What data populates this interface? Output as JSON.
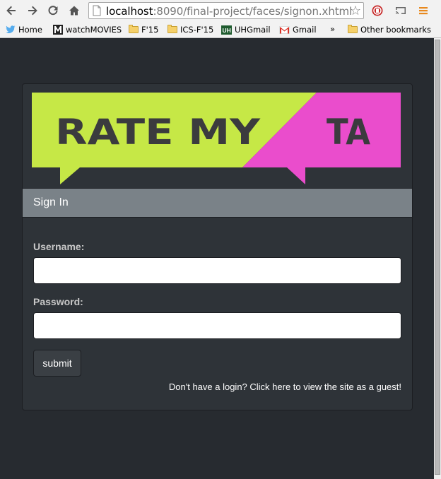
{
  "browser": {
    "url_host": "localhost",
    "url_rest": ":8090/final-project/faces/signon.xhtml",
    "bookmarks": {
      "home": "Home",
      "watchmovies": "watchMOVIES",
      "f15": "F'15",
      "icsf15": "ICS-F'15",
      "uhgmail": "UHGmail",
      "gmail": "Gmail",
      "overflow": "»",
      "other": "Other bookmarks"
    }
  },
  "logo": {
    "text_left": "RATE MY",
    "text_right": "TA",
    "colors": {
      "green": "#c6e846",
      "pink": "#ea4dcc",
      "text": "#3b3b3e"
    }
  },
  "signin": {
    "heading": "Sign In",
    "username_label": "Username:",
    "username_value": "",
    "password_label": "Password:",
    "password_value": "",
    "submit_label": "submit",
    "guest_link": "Don't have a login? Click here to view the site as a guest!"
  }
}
